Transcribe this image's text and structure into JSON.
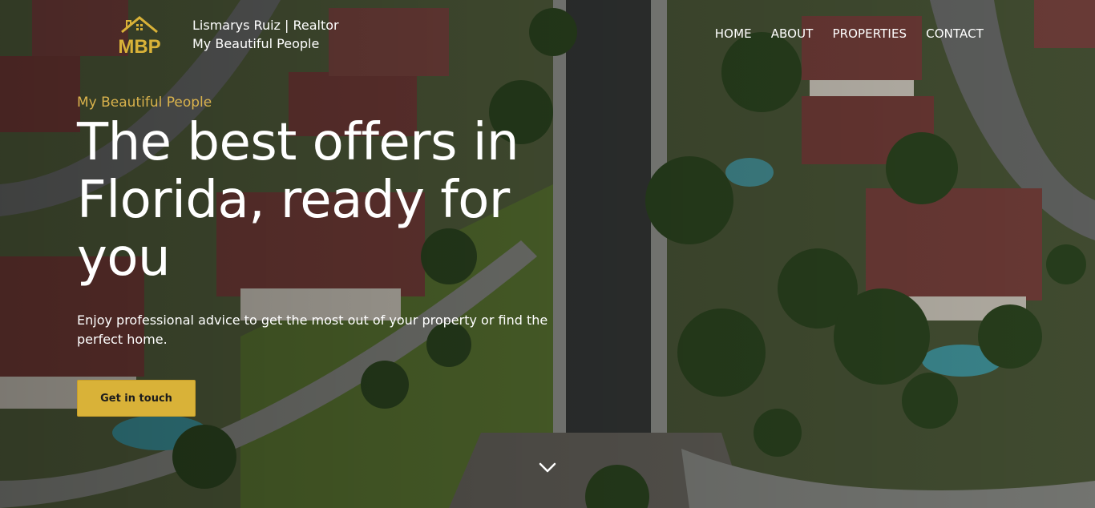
{
  "header": {
    "brand_line1": "Lismarys Ruiz | Realtor",
    "brand_line2": "My Beautiful People",
    "logo_text": "MBP"
  },
  "nav": {
    "items": [
      {
        "label": "HOME"
      },
      {
        "label": "ABOUT"
      },
      {
        "label": "PROPERTIES"
      },
      {
        "label": "CONTACT"
      }
    ]
  },
  "hero": {
    "eyebrow": "My Beautiful People",
    "headline": "The best offers in Florida, ready for you",
    "subtitle": "Enjoy professional advice to get the most out of your property or find the perfect home.",
    "cta_label": "Get in touch"
  },
  "icons": {
    "scroll": "chevron-down-icon",
    "logo": "house-logo-icon"
  },
  "colors": {
    "accent": "#d9b238",
    "eyebrow": "#d9b24c",
    "text": "#ffffff"
  }
}
